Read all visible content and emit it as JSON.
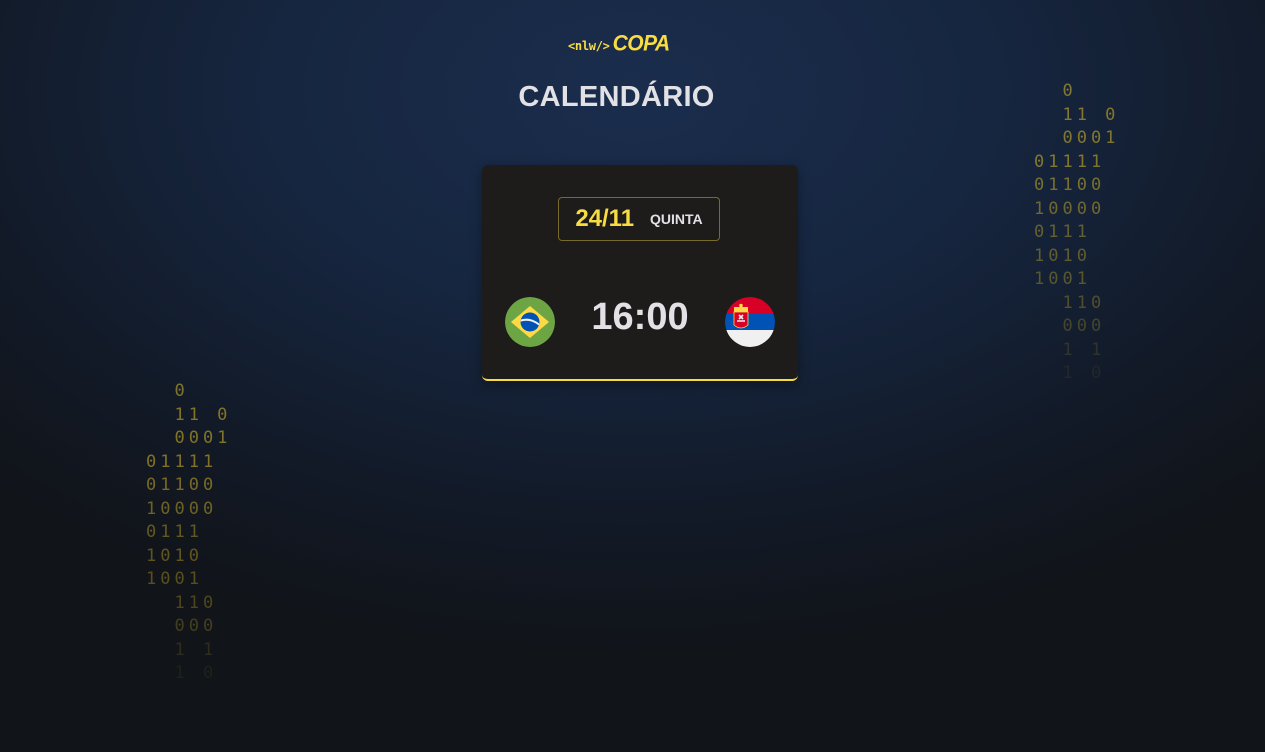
{
  "logo": {
    "tag": "<nlw/>",
    "name": "COPA"
  },
  "page": {
    "title": "CALENDÁRIO"
  },
  "match": {
    "date": "24/11",
    "weekday": "QUINTA",
    "time": "16:00",
    "home_flag": "brazil-flag-icon",
    "away_flag": "serbia-flag-icon"
  },
  "decor": {
    "binary_rows": [
      "0",
      "11 0",
      "0001",
      "01111",
      "01100",
      "10000",
      "0111",
      "1010",
      "1001",
      "110",
      "000",
      "1 1",
      "1 0"
    ]
  },
  "colors": {
    "accent": "#f7dd43",
    "text": "#e1e1e6",
    "card": "#1e1c1a"
  }
}
